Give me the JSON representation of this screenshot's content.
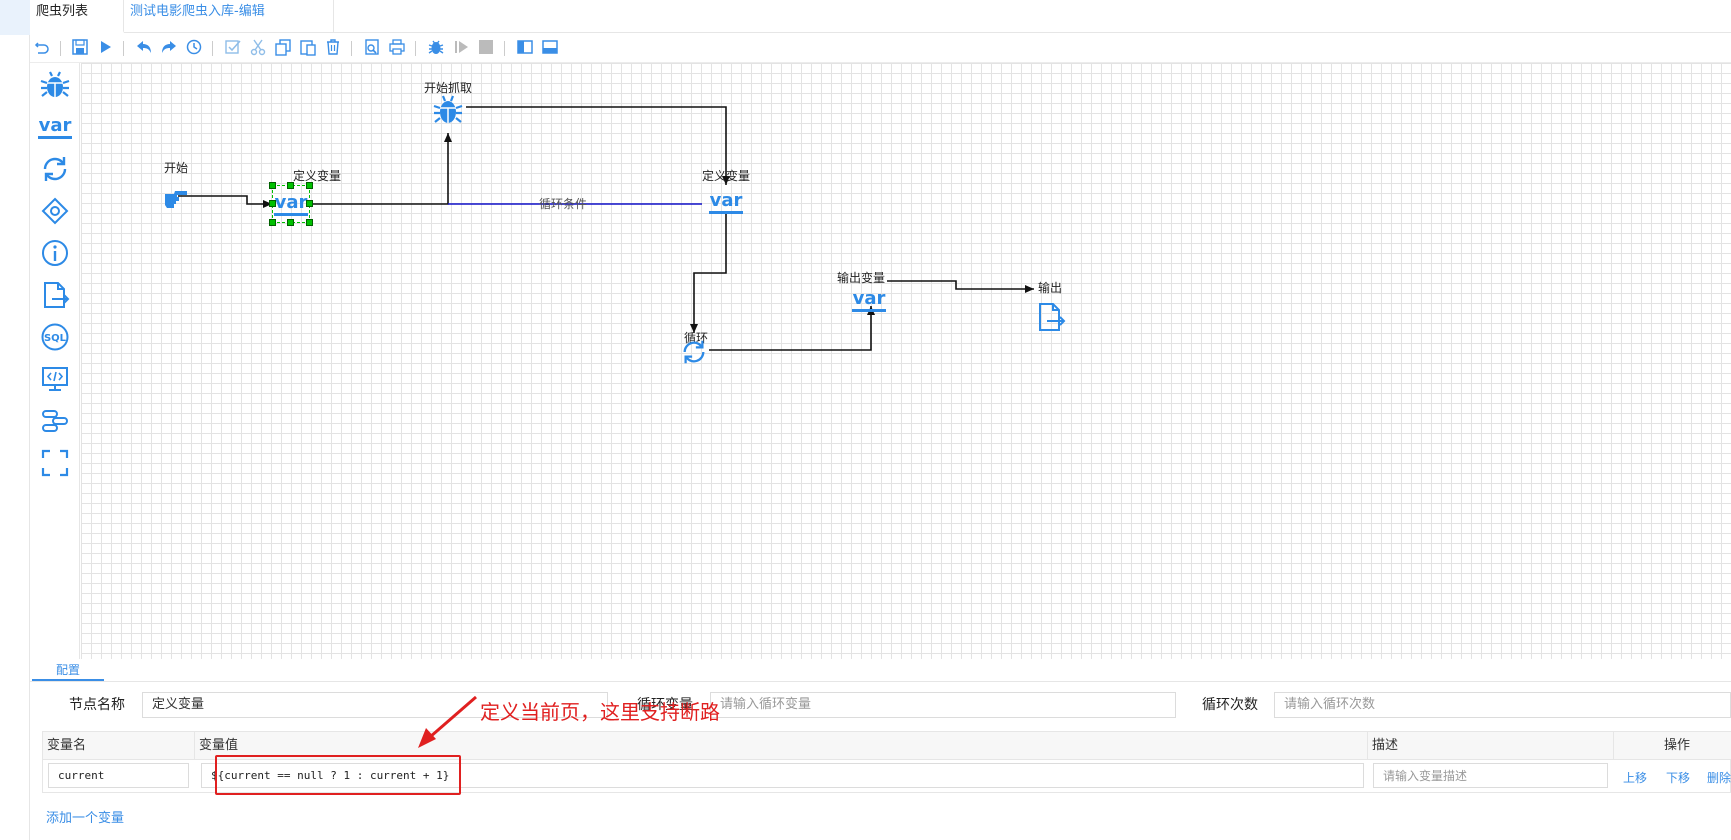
{
  "tabs": [
    {
      "label": "爬虫列表"
    },
    {
      "label": "测试电影爬虫入库-编辑"
    }
  ],
  "toolbar": {
    "icons": [
      "undo-icon",
      "save-icon",
      "run-icon",
      "undo-arrow-icon",
      "redo-arrow-icon",
      "history-icon",
      "select-all-icon",
      "cut-icon",
      "copy-icon",
      "paste-icon",
      "delete-icon",
      "print-preview-icon",
      "print-icon",
      "debug-icon",
      "step-icon",
      "stop-icon",
      "panel-left-icon",
      "panel-bottom-icon"
    ]
  },
  "palette": {
    "icons": [
      "spider-icon",
      "var-icon",
      "loop-icon",
      "condition-icon",
      "info-icon",
      "output-file-icon",
      "sql-icon",
      "code-icon",
      "function-icon",
      "frame-icon"
    ],
    "var_text": "var"
  },
  "canvas": {
    "nodes": {
      "start": {
        "label": "开始"
      },
      "define1": {
        "label": "定义变量",
        "icon_text": "var"
      },
      "crawl": {
        "label": "开始抓取"
      },
      "define2": {
        "label": "定义变量",
        "icon_text": "var"
      },
      "loop": {
        "label": "循环"
      },
      "outvar": {
        "label": "输出变量",
        "icon_text": "var"
      },
      "output": {
        "label": "输出"
      }
    },
    "edge_label": "循环条件"
  },
  "config": {
    "tab_label": "配置",
    "node_name_label": "节点名称",
    "node_name_value": "定义变量",
    "loop_var_label": "循环变量",
    "loop_var_placeholder": "请输入循环变量",
    "loop_count_label": "循环次数",
    "loop_count_placeholder": "请输入循环次数",
    "table": {
      "headers": {
        "name": "变量名",
        "value": "变量值",
        "desc": "描述",
        "ops": "操作"
      },
      "rows": [
        {
          "name": "current",
          "value": "${current == null ? 1 : current + 1}",
          "desc_placeholder": "请输入变量描述",
          "up": "上移",
          "down": "下移",
          "delete": "删除"
        }
      ]
    },
    "add_link": "添加一个变量"
  },
  "annotation": {
    "text": "定义当前页，这里支持断路"
  },
  "colors": {
    "accent": "#3a8ee6",
    "icon_blue": "#2d8ae6",
    "selected_green": "#00c000",
    "annotation_red": "#e02020",
    "edge_blue": "#1010c8"
  }
}
